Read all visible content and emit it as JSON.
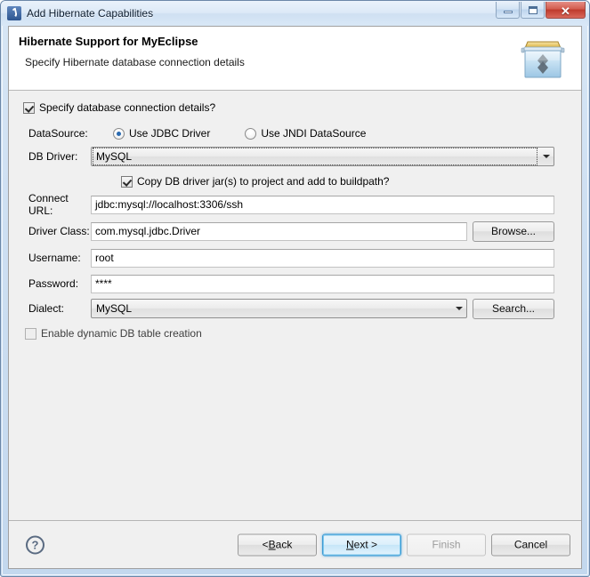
{
  "window": {
    "title": "Add Hibernate Capabilities",
    "title_icon": "hibernate-app-icon",
    "controls": {
      "minimize": "minimize-icon",
      "maximize": "restore-icon",
      "close": "✕"
    }
  },
  "header": {
    "title": "Hibernate Support for MyEclipse",
    "subtitle": "Specify Hibernate database connection details",
    "icon": "hibernate-box-icon"
  },
  "form": {
    "specify_db": {
      "label": "Specify database connection details?",
      "checked": true
    },
    "datasource": {
      "label": "DataSource:",
      "options": [
        {
          "label": "Use JDBC Driver",
          "selected": true
        },
        {
          "label": "Use JNDI DataSource",
          "selected": false
        }
      ]
    },
    "db_driver": {
      "label": "DB Driver:",
      "value": "MySQL",
      "focused": true
    },
    "copy_jars": {
      "label": "Copy DB driver jar(s) to project and add to buildpath?",
      "checked": true
    },
    "connect_url": {
      "label": "Connect URL:",
      "value": "jdbc:mysql://localhost:3306/ssh"
    },
    "driver_class": {
      "label": "Driver Class:",
      "value": "com.mysql.jdbc.Driver",
      "browse_label": "Browse..."
    },
    "username": {
      "label": "Username:",
      "value": "root"
    },
    "password": {
      "label": "Password:",
      "value": "****"
    },
    "dialect": {
      "label": "Dialect:",
      "value": "MySQL",
      "search_label": "Search..."
    },
    "dynamic_table": {
      "label": "Enable dynamic DB table creation",
      "checked": false
    }
  },
  "buttonbar": {
    "help": "?",
    "back": "< Back",
    "next_prefix": "",
    "next_key": "N",
    "next_suffix": "ext >",
    "back_prefix": "< ",
    "back_key": "B",
    "back_suffix": "ack",
    "finish": "Finish",
    "cancel": "Cancel"
  },
  "colors": {
    "frame": "#c3d8ee",
    "client_bg": "#f0f0f0",
    "header_bg": "#ffffff",
    "default_button_border": "#3c9ad4",
    "close_button": "#bf3a2c",
    "radio_dot": "#2a6ab0"
  }
}
